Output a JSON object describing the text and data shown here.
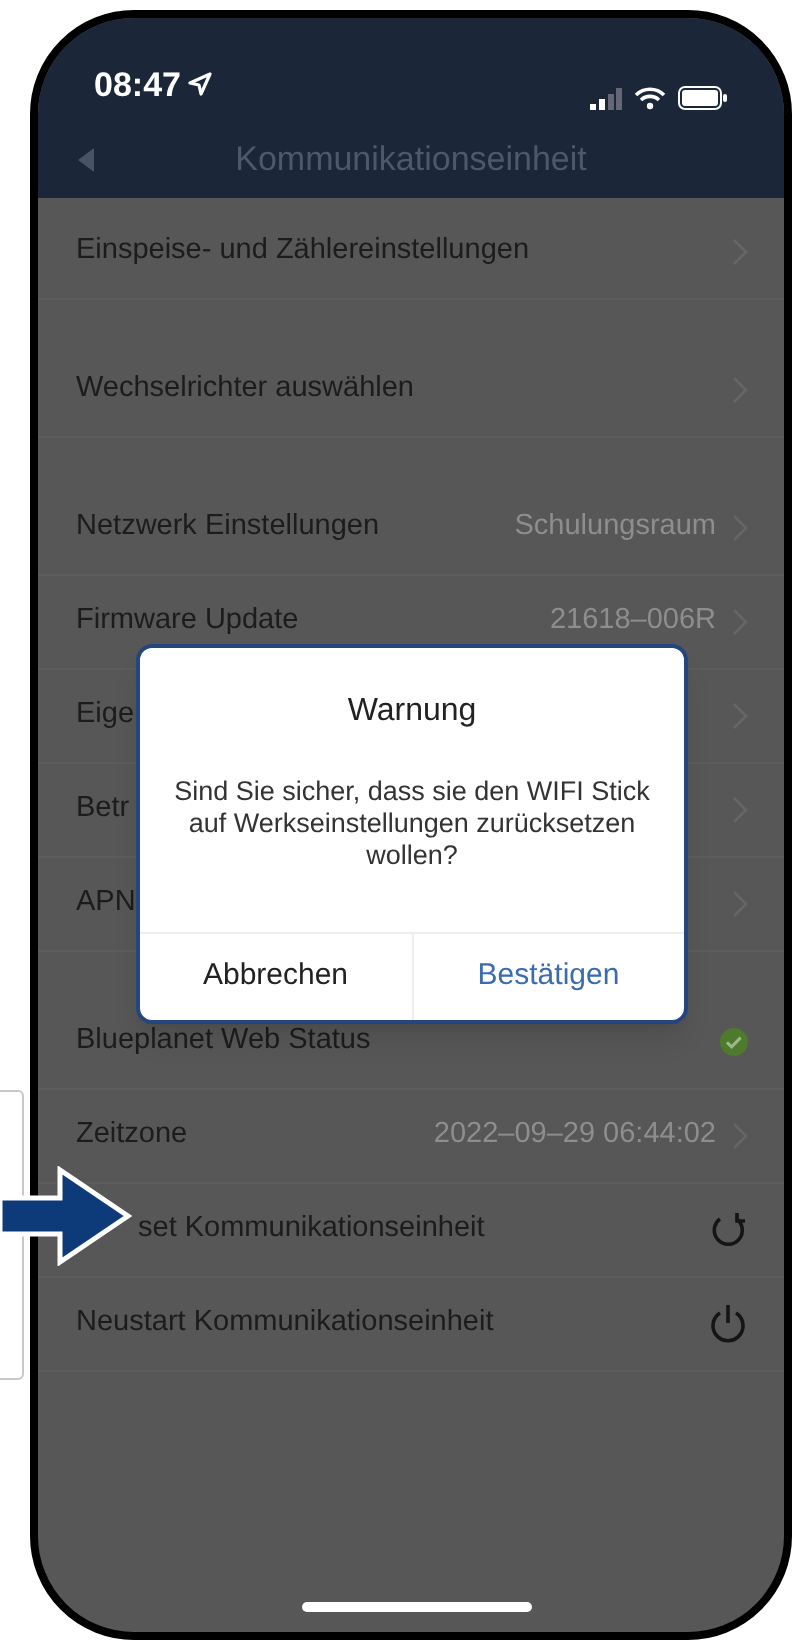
{
  "status_bar": {
    "time": "08:47"
  },
  "header": {
    "title": "Kommunikationseinheit"
  },
  "sections": [
    {
      "rows": [
        {
          "label": "Einspeise- und Zählereinstellungen",
          "kind": "chevron"
        }
      ]
    },
    {
      "rows": [
        {
          "label": "Wechselrichter auswählen",
          "kind": "chevron"
        }
      ]
    },
    {
      "rows": [
        {
          "label": "Netzwerk Einstellungen",
          "value": "Schulungsraum",
          "kind": "chevron"
        },
        {
          "label": "Firmware Update",
          "value": "21618–006R",
          "kind": "chevron"
        },
        {
          "label": "Eige",
          "kind": "chevron"
        },
        {
          "label": "Betr",
          "kind": "chevron"
        },
        {
          "label": "APN",
          "kind": "chevron"
        }
      ]
    },
    {
      "rows": [
        {
          "label": "Blueplanet Web Status",
          "kind": "check"
        },
        {
          "label": "Zeitzone",
          "value": "2022–09–29 06:44:02",
          "kind": "chevron"
        },
        {
          "label": "set Kommunikationseinheit",
          "kind": "refresh"
        },
        {
          "label": "Neustart Kommunikationseinheit",
          "kind": "power"
        }
      ]
    }
  ],
  "dialog": {
    "title": "Warnung",
    "message": "Sind Sie sicher, dass sie den WIFI Stick auf Werkseinstellungen zurücksetzen wollen?",
    "buttons": [
      {
        "label": "Abbrechen",
        "kind": "cancel"
      },
      {
        "label": "Bestätigen",
        "kind": "confirm"
      }
    ]
  }
}
